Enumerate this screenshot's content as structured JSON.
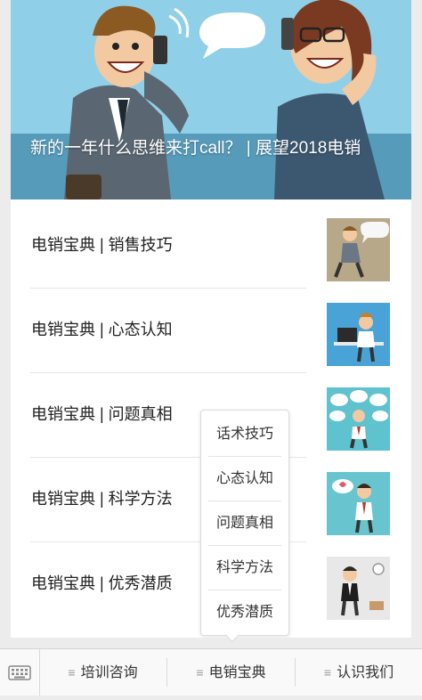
{
  "hero": {
    "title": "新的一年什么思维来打call？ | 展望2018电销"
  },
  "articles": [
    {
      "title": "电销宝典 | 销售技巧"
    },
    {
      "title": "电销宝典 | 心态认知"
    },
    {
      "title": "电销宝典 | 问题真相"
    },
    {
      "title": "电销宝典 | 科学方法"
    },
    {
      "title": "电销宝典 | 优秀潜质"
    }
  ],
  "submenu": {
    "items": [
      "话术技巧",
      "心态认知",
      "问题真相",
      "科学方法",
      "优秀潜质"
    ]
  },
  "tabbar": {
    "menu_icon": "≡",
    "tabs": [
      "培训咨询",
      "电销宝典",
      "认识我们"
    ]
  },
  "colors": {
    "hero_bg": "#8fd0e8",
    "thumb_bg": "#4aa3d6"
  }
}
